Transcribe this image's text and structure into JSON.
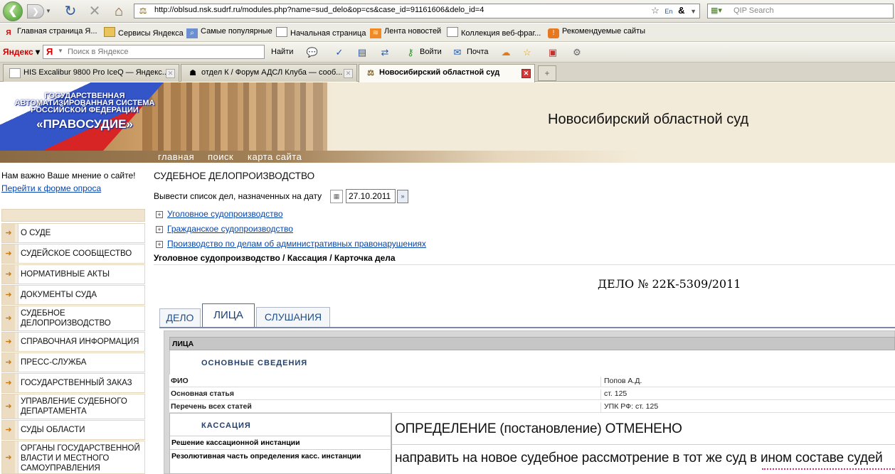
{
  "browser": {
    "url": "http://oblsud.nsk.sudrf.ru/modules.php?name=sud_delo&op=cs&case_id=91161606&delo_id=4",
    "qip_placeholder": "QIP Search",
    "bookmarks": [
      "Главная страница Я...",
      "Сервисы Яндекса",
      "Самые популярные",
      "Начальная страница",
      "Лента новостей",
      "Коллекция веб-фраг...",
      "Рекомендуемые сайты"
    ],
    "yandex": {
      "logo": "Яндекс",
      "search_placeholder": "Поиск в Яндексе",
      "find": "Найти",
      "login": "Войти",
      "mail": "Почта"
    },
    "tabs": [
      "HIS Excalibur 9800 Pro IceQ — Яндекс...",
      "отдел К / Форум АДСЛ Клуба — сооб...",
      "Новосибирский областной суд"
    ]
  },
  "header": {
    "system_line1": "ГОСУДАРСТВЕННАЯ",
    "system_line2": "АВТОМАТИЗИРОВАННАЯ СИСТЕМА",
    "system_line3": "РОССИЙСКОЙ ФЕДЕРАЦИИ",
    "system_name": "«ПРАВОСУДИЕ»",
    "court": "Новосибирский областной суд",
    "menu": [
      "главная",
      "поиск",
      "карта сайта"
    ]
  },
  "sidebar": {
    "poll_text": "Нам важно Ваше мнение о сайте!",
    "poll_link": "Перейти к форме опроса",
    "items": [
      "О СУДЕ",
      "СУДЕЙСКОЕ СООБЩЕСТВО",
      "НОРМАТИВНЫЕ АКТЫ",
      "ДОКУМЕНТЫ СУДА",
      "СУДЕБНОЕ ДЕЛОПРОИЗВОДСТВО",
      "СПРАВОЧНАЯ ИНФОРМАЦИЯ",
      "ПРЕСС-СЛУЖБА",
      "ГОСУДАРСТВЕННЫЙ ЗАКАЗ",
      "УПРАВЛЕНИЕ СУДЕБНОГО ДЕПАРТАМЕНТА",
      "СУДЫ ОБЛАСТИ",
      "ОРГАНЫ ГОСУДАРСТВЕННОЙ ВЛАСТИ И МЕСТНОГО САМОУПРАВЛЕНИЯ"
    ]
  },
  "main": {
    "title": "СУДЕБНОЕ ДЕЛОПРОИЗВОДСТВО",
    "date_label": "Вывести список дел, назначенных на дату",
    "date_value": "27.10.2011",
    "tree": [
      "Уголовное судопроизводство",
      "Гражданское судопроизводство",
      "Производство по делам об административных правонарушениях"
    ],
    "breadcrumb": "Уголовное судопроизводство / Кассация / Карточка дела",
    "case_number": "ДЕЛО № 22К-5309/2011",
    "case_tabs": [
      "ДЕЛО",
      "ЛИЦА",
      "СЛУШАНИЯ"
    ],
    "grid": {
      "header": "ЛИЦА",
      "section1": "ОСНОВНЫЕ СВЕДЕНИЯ",
      "rows": [
        {
          "key": "ФИО",
          "value": "Попов А.Д."
        },
        {
          "key": "Основная статья",
          "value": "ст. 125"
        },
        {
          "key": "Перечень всех статей",
          "value": "УПК РФ: ст. 125"
        }
      ],
      "section2": "КАССАЦИЯ",
      "kass_rows": [
        {
          "key": "Решение кассационной инстанции",
          "value": "ОПРЕДЕЛЕНИЕ (постановление) ОТМЕНЕНО"
        },
        {
          "key": "Резолютивная часть определения касс. инстанции",
          "value": "направить на новое судебное рассмотрение в тот же суд в ином составе судей"
        }
      ]
    }
  }
}
